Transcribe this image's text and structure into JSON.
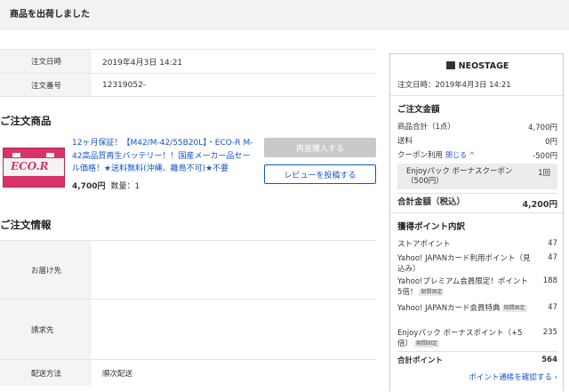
{
  "header": {
    "title": "商品を出荷しました"
  },
  "order_info": [
    {
      "label": "注文日時",
      "value": "2019年4月3日 14:21"
    },
    {
      "label": "注文番号",
      "value": "12319052-"
    }
  ],
  "items_section": {
    "title": "ご注文商品"
  },
  "product": {
    "thumb_brand": "ECO.R",
    "name": "12ヶ月保証！【M42/M-42/55B20L】・ECO-R M-42高品質再生バッテリー！！国産メーカー品セール価格！★送料無料(沖縄、離島不可)★不要",
    "price": "4,700円",
    "qty": "数量：1",
    "rebuy_label": "再度購入する",
    "review_label": "レビューを投稿する"
  },
  "shipping_section": {
    "title": "ご注文情報"
  },
  "shipping_info": [
    {
      "label": "お届け先",
      "value": ""
    },
    {
      "label": "請求先",
      "value": ""
    },
    {
      "label": "配送方法",
      "value": "順次配送"
    }
  ],
  "sidebar": {
    "store_name": "NEOSTAGE",
    "order_date": "注文日時：2019年4月3日 14:21",
    "amount_title": "ご注文金額",
    "subtotal_label": "商品合計（1点）",
    "subtotal_value": "4,700円",
    "shipping_label": "送料",
    "shipping_value": "0円",
    "coupon_label": "クーポン利用",
    "coupon_close": "閉じる ^",
    "coupon_value": "-500円",
    "coupon_detail": "Enjoyパック ボーナスクーポン（500円）",
    "coupon_count": "1回",
    "total_label": "合計金額（税込）",
    "total_value": "4,200円",
    "points_title": "獲得ポイント内訳",
    "points": [
      {
        "label": "ストアポイント",
        "value": "47",
        "tag": ""
      },
      {
        "label": "Yahoo! JAPANカード利用ポイント（見込み）",
        "value": "47",
        "tag": ""
      },
      {
        "label": "Yahoo!プレミアム会員限定！ポイント5倍！",
        "value": "188",
        "tag": "期間固定"
      },
      {
        "label": "Yahoo! JAPANカード会員特典",
        "value": "47",
        "tag": "期間固定"
      },
      {
        "label": "Enjoyパック ボーナスポイント（+5倍）",
        "value": "235",
        "tag": "期間固定"
      }
    ],
    "points_total_label": "合計ポイント",
    "points_total_value": "564",
    "points_link": "ポイント通帳を確認する ›"
  }
}
